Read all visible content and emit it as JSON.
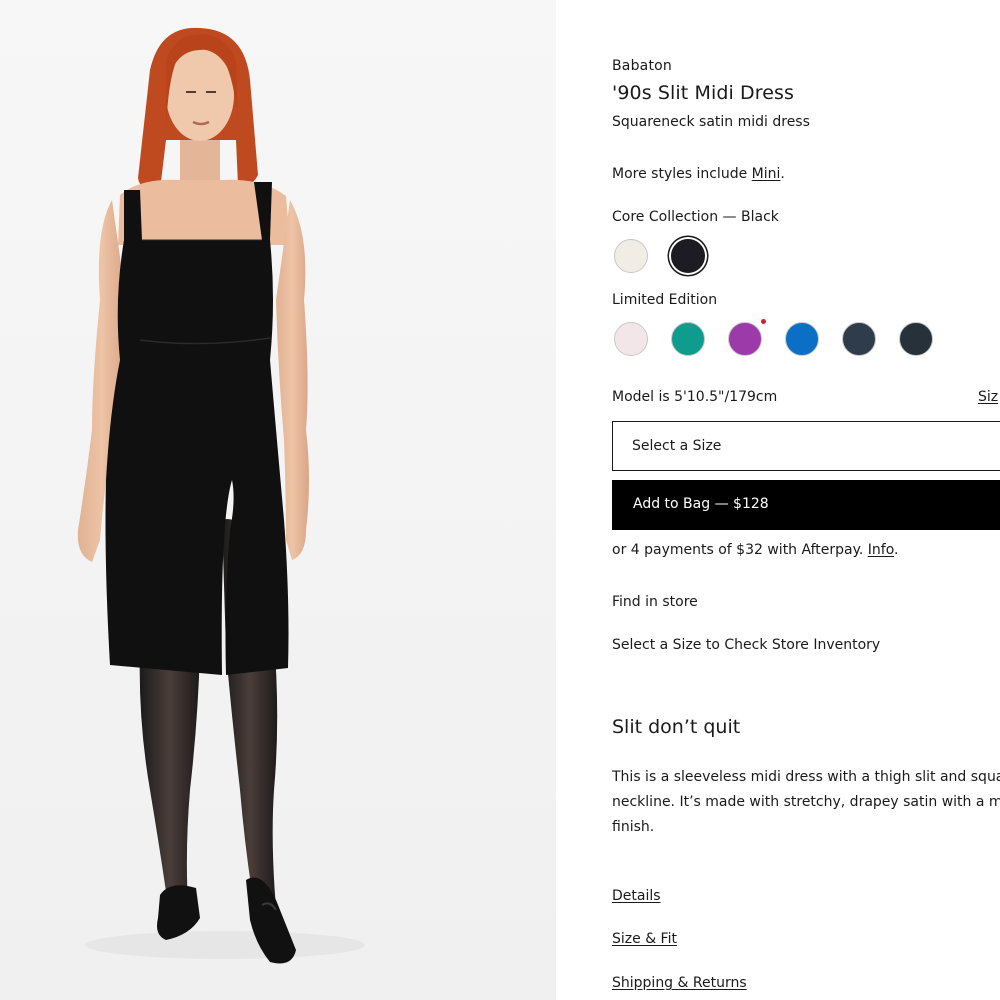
{
  "product": {
    "brand": "Babaton",
    "title": "'90s Slit Midi Dress",
    "subtitle": "Squareneck satin midi dress"
  },
  "more_styles": {
    "prefix": "More styles include ",
    "link": "Mini",
    "suffix": "."
  },
  "core_collection": {
    "label": "Core Collection — Black",
    "swatches": [
      {
        "name": "ivory",
        "color": "#f1ede5",
        "selected": false
      },
      {
        "name": "black",
        "color": "#1c1c22",
        "selected": true
      }
    ]
  },
  "limited_edition": {
    "label": "Limited Edition",
    "swatches": [
      {
        "name": "pale-pink",
        "color": "#f3e6e8",
        "new": false
      },
      {
        "name": "teal",
        "color": "#0f9b8e",
        "new": false
      },
      {
        "name": "purple",
        "color": "#9b3aa8",
        "new": true
      },
      {
        "name": "blue",
        "color": "#0b6fc6",
        "new": false
      },
      {
        "name": "navy-slate",
        "color": "#2f3c4b",
        "new": false
      },
      {
        "name": "charcoal",
        "color": "#26313a",
        "new": false
      }
    ]
  },
  "model_info": "Model is 5'10.5\"/179cm",
  "size_guide_label": "Siz",
  "size_select": {
    "placeholder": "Select a Size"
  },
  "add_to_bag": {
    "label": "Add to Bag — $128"
  },
  "afterpay": {
    "text": "or 4 payments of $32 with Afterpay. ",
    "link": "Info",
    "suffix": "."
  },
  "find_in_store": "Find in store",
  "check_inventory": "Select a Size to Check Store Inventory",
  "description": {
    "heading": "Slit don’t quit",
    "lines": [
      "This is a sleeveless midi dress with a thigh slit and squa",
      "neckline. It’s made with stretchy, drapey satin with a m",
      "finish."
    ]
  },
  "accordions": [
    "Details",
    "Size & Fit",
    "Shipping & Returns"
  ],
  "colors": {
    "accent": "#000000",
    "text": "#1a1a1a",
    "image_bg": "#f6f6f6",
    "new_dot": "#d21e2b"
  }
}
